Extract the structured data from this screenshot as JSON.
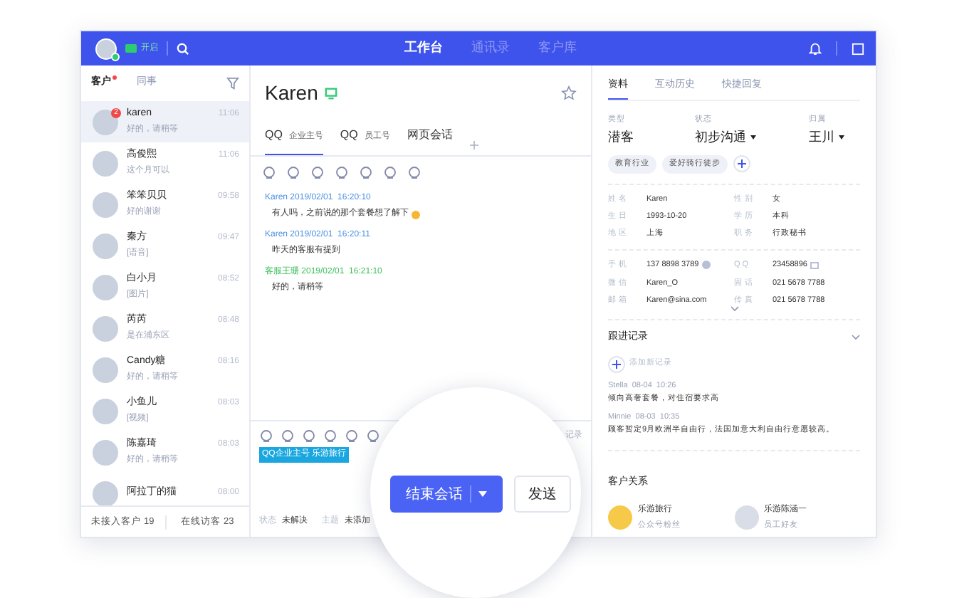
{
  "topbar": {
    "status": "开启",
    "nav": [
      {
        "label": "工作台",
        "selected": true
      },
      {
        "label": "通讯录",
        "selected": false
      },
      {
        "label": "客户库",
        "selected": false
      }
    ]
  },
  "contact_tabs": [
    {
      "label": "客户",
      "selected": true,
      "dot": true
    },
    {
      "label": "同事",
      "selected": false,
      "dot": false
    }
  ],
  "contacts": [
    {
      "name": "karen",
      "preview": "好的，请稍等",
      "time": "11:06",
      "selected": true,
      "badge": "2"
    },
    {
      "name": "高俊熙",
      "preview": "这个月可以",
      "time": "11:06",
      "selected": false
    },
    {
      "name": "笨笨贝贝",
      "preview": "好的谢谢",
      "time": "09:58",
      "selected": false
    },
    {
      "name": "秦方",
      "preview": "[语音]",
      "time": "09:47",
      "selected": false
    },
    {
      "name": "白小月",
      "preview": "[图片]",
      "time": "08:52",
      "selected": false
    },
    {
      "name": "芮芮",
      "preview": "是在浦东区",
      "time": "08:48",
      "selected": false
    },
    {
      "name": "Candy糖",
      "preview": "好的，请稍等",
      "time": "08:16",
      "selected": false
    },
    {
      "name": "小鱼儿",
      "preview": "[视频]",
      "time": "08:03",
      "selected": false
    },
    {
      "name": "陈嘉琦",
      "preview": "好的，请稍等",
      "time": "08:03",
      "selected": false
    },
    {
      "name": "阿拉丁的猫",
      "time": "08:00",
      "selected": false
    }
  ],
  "contact_footer": [
    "未接入客户 19",
    "在线访客 23"
  ],
  "chat": {
    "name": "Karen",
    "tabs": [
      {
        "label": "QQ",
        "sub": "企业主号",
        "selected": true
      },
      {
        "label": "QQ",
        "sub": "员工号",
        "selected": false
      },
      {
        "label": "网页会话",
        "selected": false
      }
    ],
    "messages": [
      {
        "kind": "customer",
        "sender": "Karen",
        "time": "2019/02/01  16:20:10",
        "text": "有人吗，之前说的那个套餐想了解下",
        "emoji": true
      },
      {
        "kind": "customer",
        "sender": "Karen",
        "time": "2019/02/01  16:20:11",
        "text": "昨天的客服有提到",
        "emoji": false
      },
      {
        "kind": "agent",
        "sender": "客服王珊",
        "time": "2019/02/01  16:21:10",
        "text": "好的，请稍等",
        "emoji": false
      }
    ],
    "composer": {
      "tag": "QQ企业主号 乐游旅行",
      "history": "记录",
      "status_label": "状态",
      "status": "未解决",
      "topic_label": "主题",
      "topic": "未添加",
      "end_button": "结束会话",
      "send_button": "发送"
    }
  },
  "profile": {
    "tabs": [
      {
        "label": "资料",
        "selected": true
      },
      {
        "label": "互动历史",
        "selected": false
      },
      {
        "label": "快捷回复",
        "selected": false
      }
    ],
    "summary": [
      {
        "label": "类型",
        "value": "潜客",
        "dropdown": false
      },
      {
        "label": "状态",
        "value": "初步沟通",
        "dropdown": true
      },
      {
        "label": "归属",
        "value": "王川",
        "dropdown": true
      }
    ],
    "tags": [
      "教育行业",
      "爱好骑行徒步"
    ],
    "info_groups": [
      [
        {
          "label": "姓 名",
          "value": "Karen"
        },
        {
          "label": "性 别",
          "value": "女"
        },
        {
          "label": "生 日",
          "value": "1993-10-20"
        },
        {
          "label": "学 历",
          "value": "本科"
        },
        {
          "label": "地 区",
          "value": "上海"
        },
        {
          "label": "职 务",
          "value": "行政秘书"
        }
      ],
      [
        {
          "kind": "phone",
          "label": "手 机",
          "value": "137 8898 3789"
        },
        {
          "kind": "card",
          "label": "Q Q",
          "value": "23458896"
        },
        {
          "kind": "plain",
          "label": "微 信",
          "value": "Karen_O"
        },
        {
          "kind": "plain",
          "label": "固 话",
          "value": "021 5678 7788"
        },
        {
          "kind": "plain",
          "label": "邮 箱",
          "value": "Karen@sina.com"
        },
        {
          "kind": "plain",
          "label": "传 真",
          "value": "021 5678 7788"
        }
      ]
    ],
    "followup": {
      "title": "跟进记录",
      "add": "添加新记录",
      "records": [
        {
          "author": "Stella",
          "time": "08-04  10:26",
          "text": "倾向高奢套餐，对住宿要求高"
        },
        {
          "author": "Minnie",
          "time": "08-03  10:35",
          "text": "顾客暂定9月欧洲半自由行，法国加意大利自由行意愿较高。"
        }
      ]
    },
    "relations": {
      "title": "客户关系",
      "items": [
        {
          "kind": "brand",
          "name": "乐游旅行",
          "sub": "公众号粉丝"
        },
        {
          "kind": "person",
          "name": "乐游陈涵一",
          "sub": "员工好友"
        }
      ]
    }
  }
}
